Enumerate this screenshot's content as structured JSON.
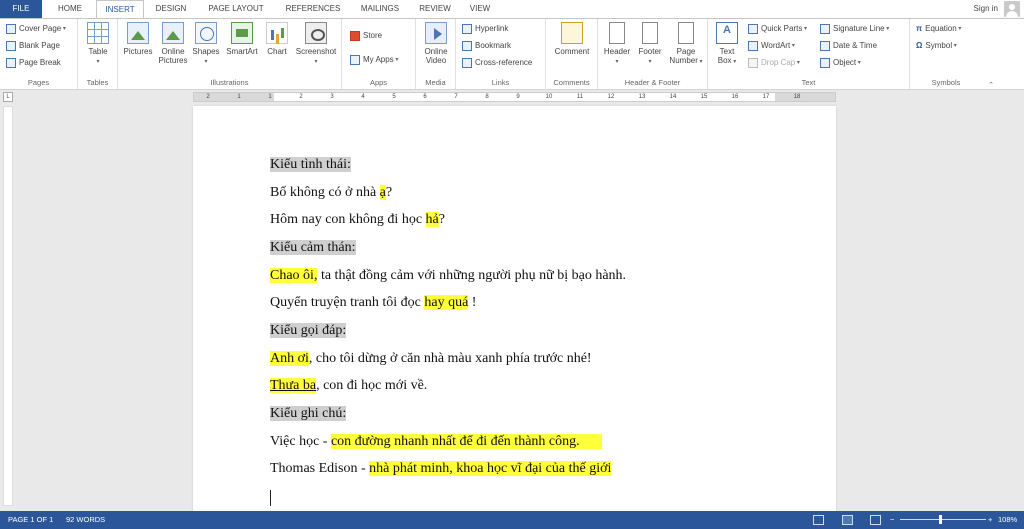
{
  "tabs": {
    "file": "FILE",
    "home": "HOME",
    "insert": "INSERT",
    "design": "DESIGN",
    "page_layout": "PAGE LAYOUT",
    "references": "REFERENCES",
    "mailings": "MAILINGS",
    "review": "REVIEW",
    "view": "VIEW"
  },
  "sign_in": "Sign in",
  "ribbon": {
    "pages": {
      "label": "Pages",
      "cover_page": "Cover Page",
      "blank_page": "Blank Page",
      "page_break": "Page Break"
    },
    "tables": {
      "label": "Tables",
      "table": "Table"
    },
    "illustrations": {
      "label": "Illustrations",
      "pictures": "Pictures",
      "online_pictures_1": "Online",
      "online_pictures_2": "Pictures",
      "shapes": "Shapes",
      "smartart": "SmartArt",
      "chart": "Chart",
      "screenshot": "Screenshot"
    },
    "apps": {
      "label": "Apps",
      "store": "Store",
      "my_apps": "My Apps"
    },
    "media": {
      "label": "Media",
      "online_video_1": "Online",
      "online_video_2": "Video"
    },
    "links": {
      "label": "Links",
      "hyperlink": "Hyperlink",
      "bookmark": "Bookmark",
      "cross_reference": "Cross-reference"
    },
    "comments": {
      "label": "Comments",
      "comment": "Comment"
    },
    "header_footer": {
      "label": "Header & Footer",
      "header": "Header",
      "footer": "Footer",
      "page_number_1": "Page",
      "page_number_2": "Number"
    },
    "text": {
      "label": "Text",
      "text_box_1": "Text",
      "text_box_2": "Box",
      "quick_parts": "Quick Parts",
      "wordart": "WordArt",
      "drop_cap": "Drop Cap",
      "signature_line": "Signature Line",
      "date_time": "Date & Time",
      "object": "Object"
    },
    "symbols": {
      "label": "Symbols",
      "equation": "Equation",
      "symbol": "Symbol"
    }
  },
  "ruler": {
    "corner": "L",
    "numbers": [
      "2",
      "1",
      "1",
      "2",
      "3",
      "4",
      "5",
      "6",
      "7",
      "8",
      "9",
      "10",
      "11",
      "12",
      "13",
      "14",
      "15",
      "16",
      "17",
      "18"
    ]
  },
  "document": {
    "h1": "Kiểu tình thái:",
    "l1a": "Bố không có ở nhà ",
    "l1b": "ạ",
    "l1c": "?",
    "l2a": "Hôm nay con không đi học ",
    "l2b": "hả",
    "l2c": "?",
    "h2": "Kiểu cảm thán:",
    "l3a": "Chao ôi,",
    "l3b": " ta thật đồng cảm với những người phụ nữ bị bạo hành.",
    "l4a": "Quyển truyện tranh tôi đọc ",
    "l4b": "hay quá",
    "l4c": " !",
    "h3": "Kiểu gọi đáp:",
    "l5a": "Anh ơi",
    "l5b": ", cho tôi dừng ở căn nhà màu xanh phía trước nhé!",
    "l6a": "Thưa ba",
    "l6b": ", con đi học mới về.",
    "h4": "Kiểu ghi chú:",
    "l7a": "Việc học - ",
    "l7b": "con đường nhanh nhất để đi đến thành công.",
    "l8a": "Thomas Edison - ",
    "l8b": "nhà phát minh, khoa học vĩ đại của thế giới"
  },
  "status": {
    "page": "PAGE 1 OF 1",
    "words": "92 WORDS",
    "zoom": "108%",
    "zoom_out": "−",
    "zoom_in": "+"
  }
}
